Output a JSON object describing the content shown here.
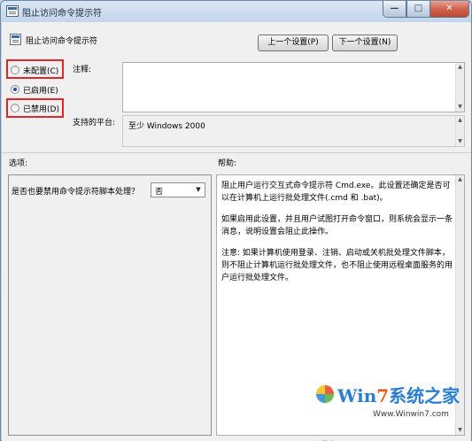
{
  "window": {
    "title": "阻止访问命令提示符",
    "minimize_glyph": "—",
    "maximize_glyph": "□",
    "close_glyph": "✕"
  },
  "header": {
    "policy_name": "阻止访问命令提示符",
    "prev_button": "上一个设置(P)",
    "next_button": "下一个设置(N)"
  },
  "state": {
    "options": [
      {
        "label": "未配置(C)",
        "selected": false
      },
      {
        "label": "已启用(E)",
        "selected": true
      },
      {
        "label": "已禁用(D)",
        "selected": false
      }
    ]
  },
  "comment": {
    "label": "注释:",
    "value": ""
  },
  "platform": {
    "label": "支持的平台:",
    "value": "至少 Windows 2000"
  },
  "options_section": {
    "label": "选项:",
    "question": "是否也要禁用命令提示符脚本处理？",
    "dropdown_value": "否"
  },
  "help_section": {
    "label": "帮助:",
    "paragraphs": [
      "阻止用户运行交互式命令提示符 Cmd.exe。此设置还确定是否可以在计算机上运行批处理文件(.cmd 和 .bat)。",
      "如果启用此设置，并且用户试图打开命令窗口，则系统会显示一条消息，说明设置会阻止此操作。",
      "注意: 如果计算机使用登录、注销、启动或关机批处理文件脚本，则不阻止计算机运行批处理文件，也不阻止使用远程桌面服务的用户运行批处理文件。"
    ]
  },
  "footer": {
    "ok_button": "确定"
  },
  "watermark": {
    "title_prefix": "Win",
    "title_seven": "7",
    "title_suffix": "系统之家",
    "url": "Www.Winwin7.com"
  },
  "colors": {
    "highlight_box": "#e0262a",
    "radio_selected": "#1d4f9a"
  }
}
